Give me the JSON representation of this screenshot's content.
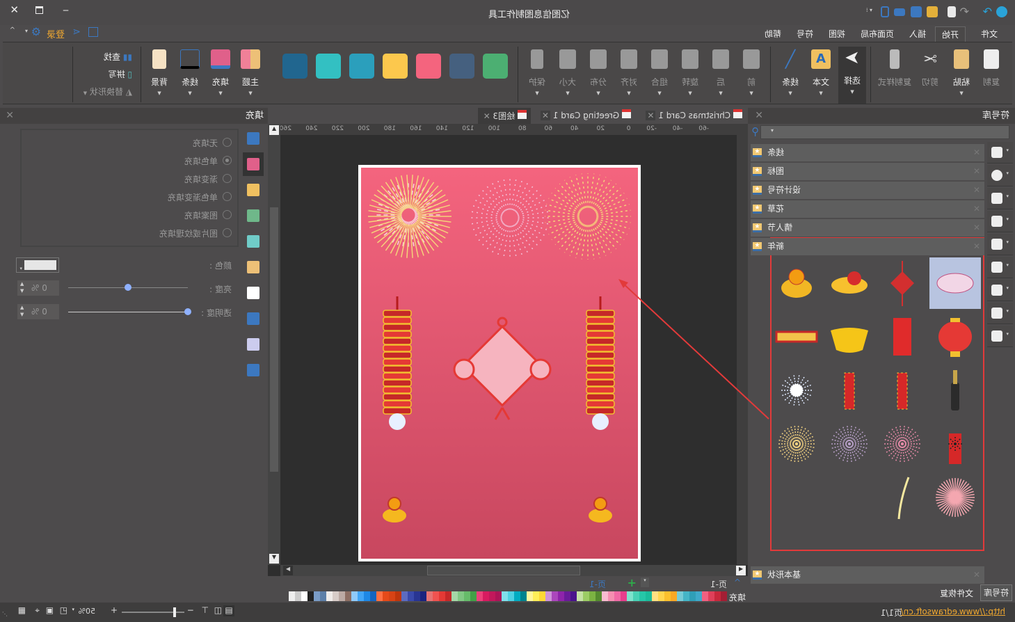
{
  "window": {
    "title": "亿图信息图制作工具"
  },
  "quick_access": [
    "app-logo-icon",
    "redo-icon",
    "undo-icon",
    "new-icon",
    "open-icon",
    "save-icon",
    "print-icon",
    "export-icon"
  ],
  "menu_tabs": [
    "文件",
    "开始",
    "插入",
    "页面布局",
    "视图",
    "符号",
    "帮助"
  ],
  "active_tab": "开始",
  "account": {
    "login": "登录"
  },
  "ribbon": {
    "clipboard": [
      "复制",
      "粘贴",
      "剪切",
      "复制样式"
    ],
    "tools": [
      "选择",
      "文本",
      "线条"
    ],
    "arrange": [
      "前",
      "后",
      "旋转",
      "组合",
      "对齐",
      "分布",
      "大小",
      "保护"
    ],
    "theme_swatches": [
      "#4caf72",
      "#45607f",
      "#f4647e",
      "#fcc84d",
      "#2b9fbc",
      "#33c0c2",
      "#21668f"
    ],
    "style": [
      "主题",
      "填充",
      "线条",
      "背景"
    ],
    "edit": {
      "find": "查找",
      "spell": "拼写",
      "replace": "替换形状"
    }
  },
  "symbol_panel": {
    "title": "符号库",
    "search_placeholder": "",
    "categories": [
      "线条",
      "图标",
      "设计符号",
      "花草",
      "情人节",
      "新年"
    ],
    "bottom_category": "基本形状",
    "symbols": [
      {
        "name": "clouds",
        "icon": "clouds"
      },
      {
        "name": "chinese-knot",
        "icon": "knot"
      },
      {
        "name": "dragon-fish",
        "icon": "fish"
      },
      {
        "name": "lion-dance",
        "icon": "lion"
      },
      {
        "name": "lantern",
        "icon": "lantern"
      },
      {
        "name": "red-envelope",
        "icon": "envelope"
      },
      {
        "name": "gold-ingot",
        "icon": "ingot"
      },
      {
        "name": "scroll-banner",
        "icon": "scroll"
      },
      {
        "name": "champagne",
        "icon": "bottle"
      },
      {
        "name": "firecracker-red",
        "icon": "cracker"
      },
      {
        "name": "firecracker-string",
        "icon": "cracker"
      },
      {
        "name": "spark-burst",
        "icon": "spark"
      },
      {
        "name": "rocket-firework",
        "icon": "rocket"
      },
      {
        "name": "firework-pink",
        "icon": "fw-pink"
      },
      {
        "name": "firework-purple",
        "icon": "fw-purple"
      },
      {
        "name": "firework-gold",
        "icon": "fw-gold"
      },
      {
        "name": "firework-burst-pink",
        "icon": "fw-burst"
      },
      {
        "name": "firework-trail",
        "icon": "trail"
      },
      {
        "name": "empty-1",
        "icon": ""
      },
      {
        "name": "empty-2",
        "icon": ""
      }
    ],
    "tabs": [
      "符号库",
      "文件恢复"
    ]
  },
  "document_tabs": [
    "Christmas Card 1",
    "Greeting Card 1",
    "绘图3"
  ],
  "ruler_labels": [
    "-60",
    "-40",
    "-20",
    "0",
    "20",
    "40",
    "60",
    "80",
    "100",
    "120",
    "140",
    "160",
    "180",
    "200",
    "220",
    "240",
    "260"
  ],
  "page_tabs": {
    "current": "页-1",
    "tab": "页-1"
  },
  "palette_label": "填充",
  "palette": [
    "#a31f34",
    "#c8283c",
    "#e0405a",
    "#f06080",
    "#3fa9c9",
    "#2f9fb7",
    "#45b5c7",
    "#76cbd6",
    "#f9a825",
    "#fbc02d",
    "#ffd54f",
    "#ffe082",
    "#1abc9c",
    "#26c6a8",
    "#48d1b5",
    "#7de3cc",
    "#e83e8c",
    "#f06aa6",
    "#f48fb1",
    "#f8bbd0",
    "#558b2f",
    "#7cb342",
    "#9ccc65",
    "#c5e1a5",
    "#4a148c",
    "#6a1b9a",
    "#8e24aa",
    "#ab47bc",
    "#ce93d8",
    "#fdd835",
    "#ffee58",
    "#fff59d",
    "#00838f",
    "#00acc1",
    "#4dd0e1",
    "#80deea",
    "#ad1457",
    "#c2185b",
    "#d81b60",
    "#ec407a",
    "#43a047",
    "#66bb6a",
    "#81c784",
    "#a5d6a7",
    "#c62828",
    "#e53935",
    "#ef5350",
    "#e57373",
    "#1a237e",
    "#283593",
    "#3949ab",
    "#5c6bc0",
    "#bf360c",
    "#d84315",
    "#e64a19",
    "#ff7043",
    "#1565c0",
    "#1e88e5",
    "#42a5f5",
    "#90caf9",
    "#8d6e63",
    "#bcaaa4",
    "#d7ccc8",
    "#efebe9",
    "#5d7fa8",
    "#7a9cc6",
    "#222222",
    "#ffffff",
    "#cccccc",
    "#eeeeee"
  ],
  "fill_panel": {
    "title": "填充",
    "options": [
      "无填充",
      "单色填充",
      "渐变填充",
      "单色渐变填充",
      "图案填充",
      "图片或纹理填充"
    ],
    "selected": "单色填充",
    "color_label": "颜色 :",
    "color_value": "#e6e6e6",
    "brightness_label": "亮度 :",
    "brightness_value": "0 %",
    "brightness_level": 0,
    "transparency_label": "透明度 :",
    "transparency_value": "0 %",
    "transparency_level": 0
  },
  "status": {
    "url": "http://www.edrawsoft.cn/",
    "page": "页1/1",
    "zoom": "50%"
  }
}
